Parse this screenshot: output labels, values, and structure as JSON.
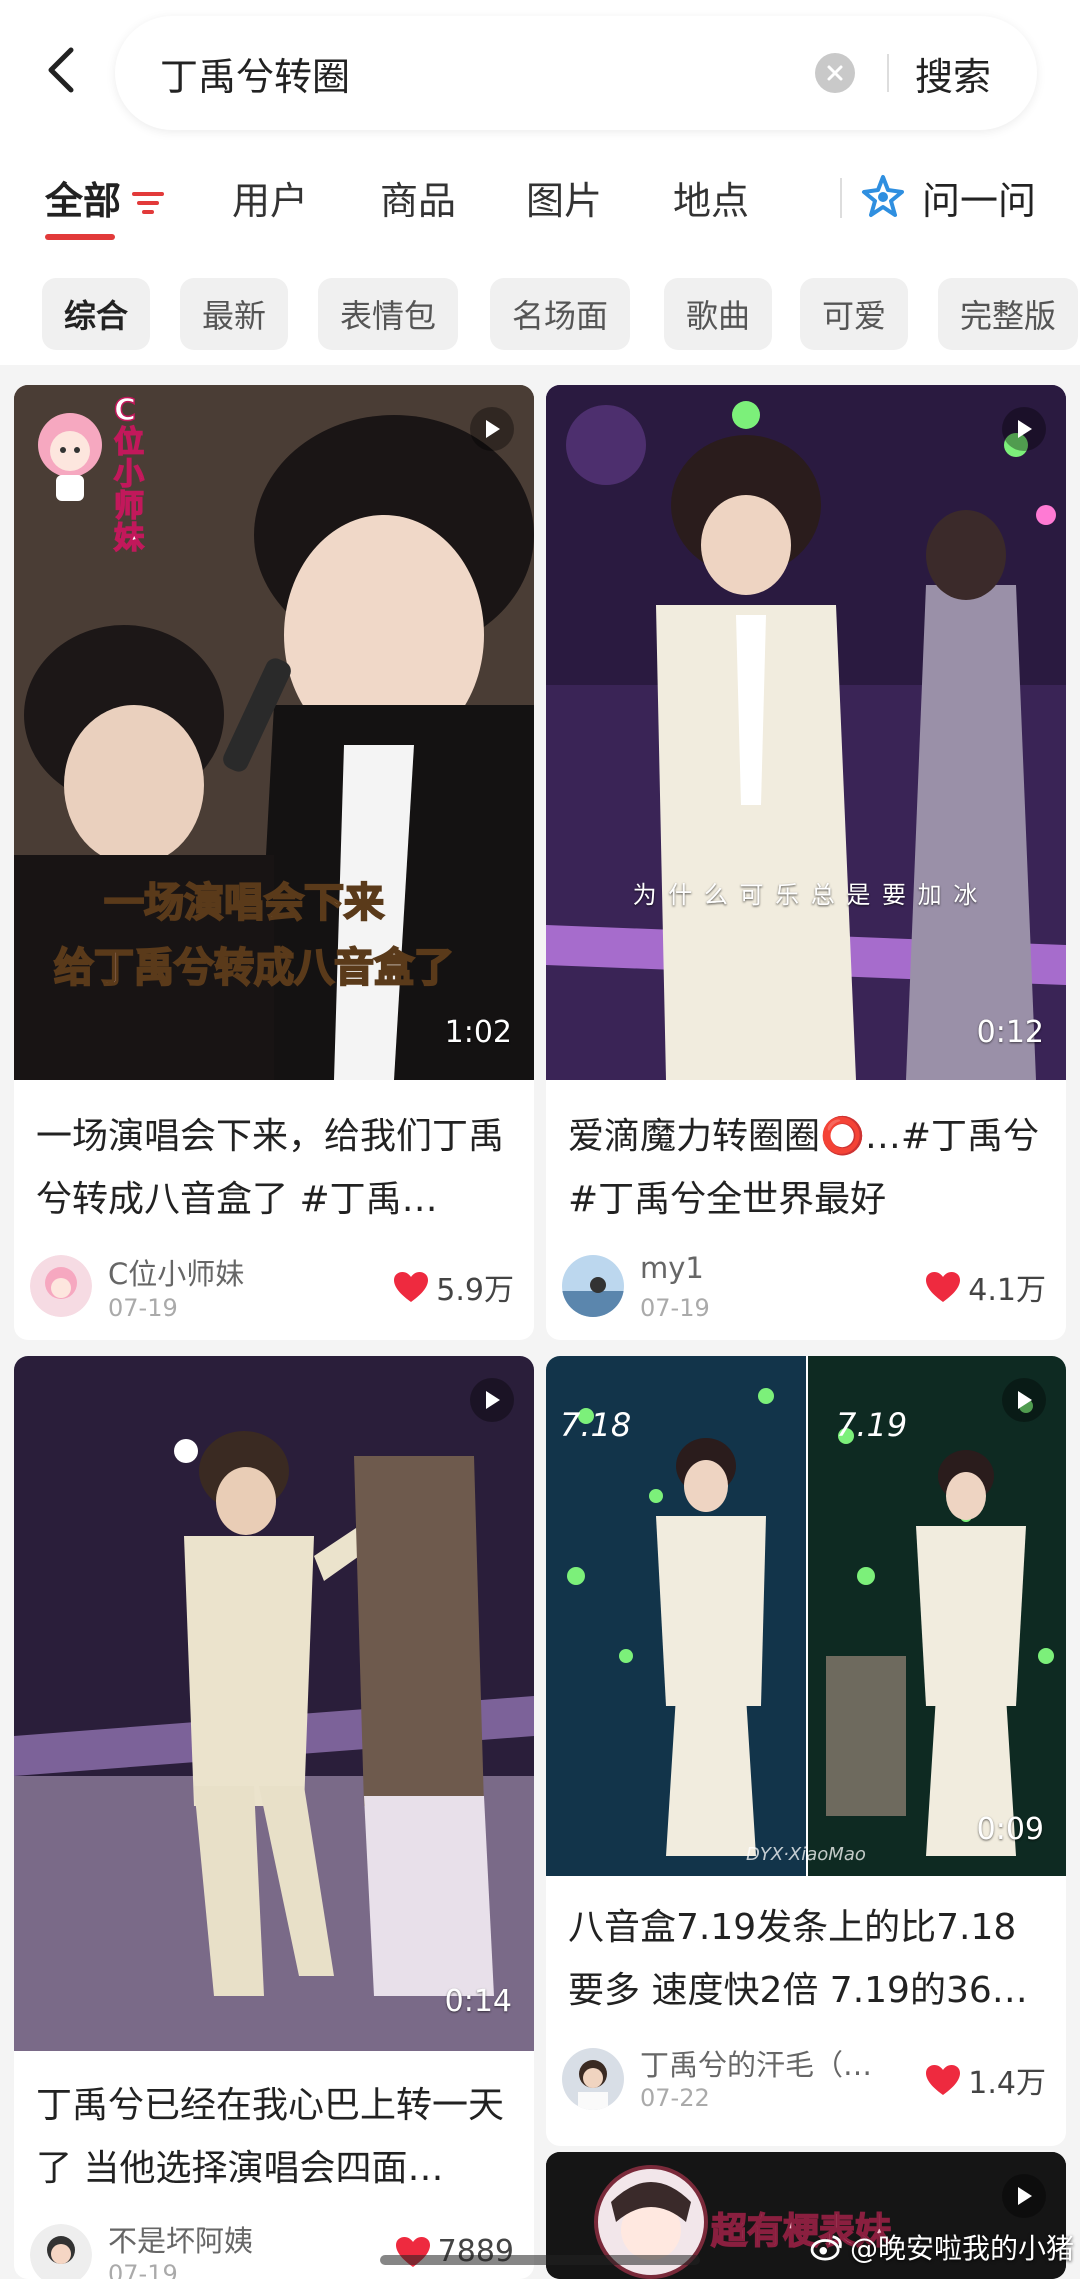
{
  "search": {
    "query": "丁禹兮转圈",
    "button_label": "搜索"
  },
  "tabs": [
    {
      "label": "全部"
    },
    {
      "label": "用户"
    },
    {
      "label": "商品"
    },
    {
      "label": "图片"
    },
    {
      "label": "地点"
    }
  ],
  "ask": {
    "label": "问一问"
  },
  "chips": [
    {
      "label": "综合"
    },
    {
      "label": "最新"
    },
    {
      "label": "表情包"
    },
    {
      "label": "名场面"
    },
    {
      "label": "歌曲"
    },
    {
      "label": "可爱"
    },
    {
      "label": "完整版"
    }
  ],
  "cards": [
    {
      "title": "一场演唱会下来，给我们丁禹兮转成八音盒了 #丁禹…",
      "overlay_line1": "一场演唱会下来",
      "overlay_line2": "给丁禹兮转成八音盒了",
      "badge": "C位小师妹",
      "duration": "1:02",
      "author": "C位小师妹",
      "date": "07-19",
      "likes": "5.9万"
    },
    {
      "title": "爱滴魔力转圈圈⭕…#丁禹兮 #丁禹兮全世界最好",
      "caption": "为 什 么 可 乐 总 是 要 加 冰",
      "duration": "0:12",
      "author": "my1",
      "date": "07-19",
      "likes": "4.1万"
    },
    {
      "title": "丁禹兮已经在我心巴上转一天了 当他选择演唱会四面…",
      "duration": "0:14",
      "author": "不是坏阿姨",
      "date": "07-19",
      "likes": "7889"
    },
    {
      "title": "八音盒7.19发条上的比7.18要多 速度快2倍 7.19的36…",
      "left_label": "7.18",
      "right_label": "7.19",
      "image_watermark": "DYX·XiaoMao",
      "duration": "0:09",
      "author": "丁禹兮的汗毛（…",
      "date": "07-22",
      "likes": "1.4万"
    },
    {
      "banner": "超有梗表妹"
    }
  ],
  "watermark": "@晚安啦我的小猪",
  "colors": {
    "accent": "#e23a3a",
    "heart": "#ee2a3f",
    "ask_icon": "#2f8fe0"
  }
}
